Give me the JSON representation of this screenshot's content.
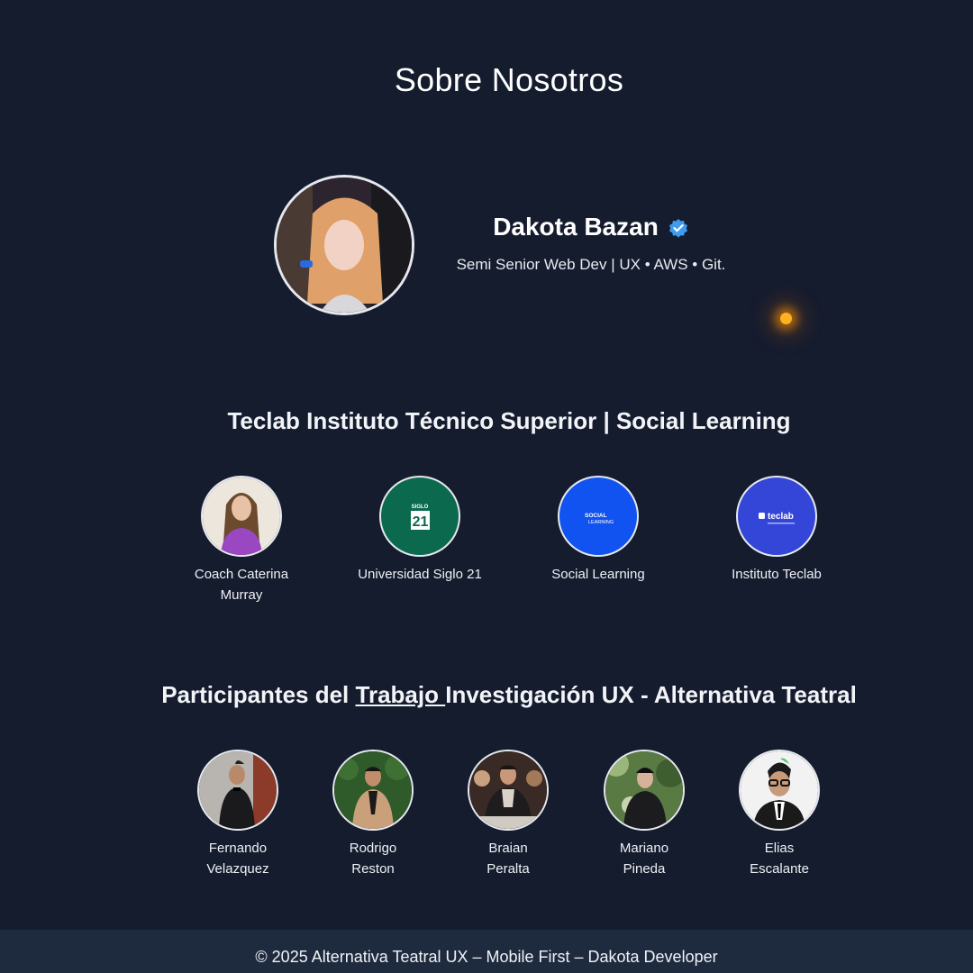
{
  "page": {
    "title": "Sobre Nosotros"
  },
  "profile": {
    "name": "Dakota Bazan",
    "role": "Semi Senior Web Dev | UX • AWS • Git."
  },
  "institutions": {
    "title": "Teclab Instituto Técnico Superior | Social Learning",
    "items": [
      {
        "label": "Coach Caterina Murray"
      },
      {
        "label": "Universidad Siglo 21",
        "logo_text_top": "SIGLO",
        "logo_text_main": "21",
        "color": "#0b6a4d"
      },
      {
        "label": "Social Learning",
        "logo_text_top": "SOCIAL",
        "logo_text_main": "LEARNING",
        "color": "#1153f0"
      },
      {
        "label": "Instituto Teclab",
        "logo_text_main": "teclab",
        "color": "#3446d8"
      }
    ]
  },
  "participants": {
    "title_prefix": "Participantes del ",
    "title_link": "Trabajo ",
    "title_suffix": "Investigación UX - Alternativa Teatral",
    "items": [
      {
        "label": "Fernando Velazquez"
      },
      {
        "label": "Rodrigo Reston"
      },
      {
        "label": "Braian Peralta"
      },
      {
        "label": "Mariano Pineda"
      },
      {
        "label": "Elias Escalante"
      }
    ]
  },
  "footer": {
    "text": "© 2025 Alternativa Teatral UX – Mobile First – Dakota Developer"
  },
  "colors": {
    "background": "#151c2e",
    "footer": "#1e2a3e",
    "verified": "#3d9bf0",
    "glow": "#ffb020"
  }
}
